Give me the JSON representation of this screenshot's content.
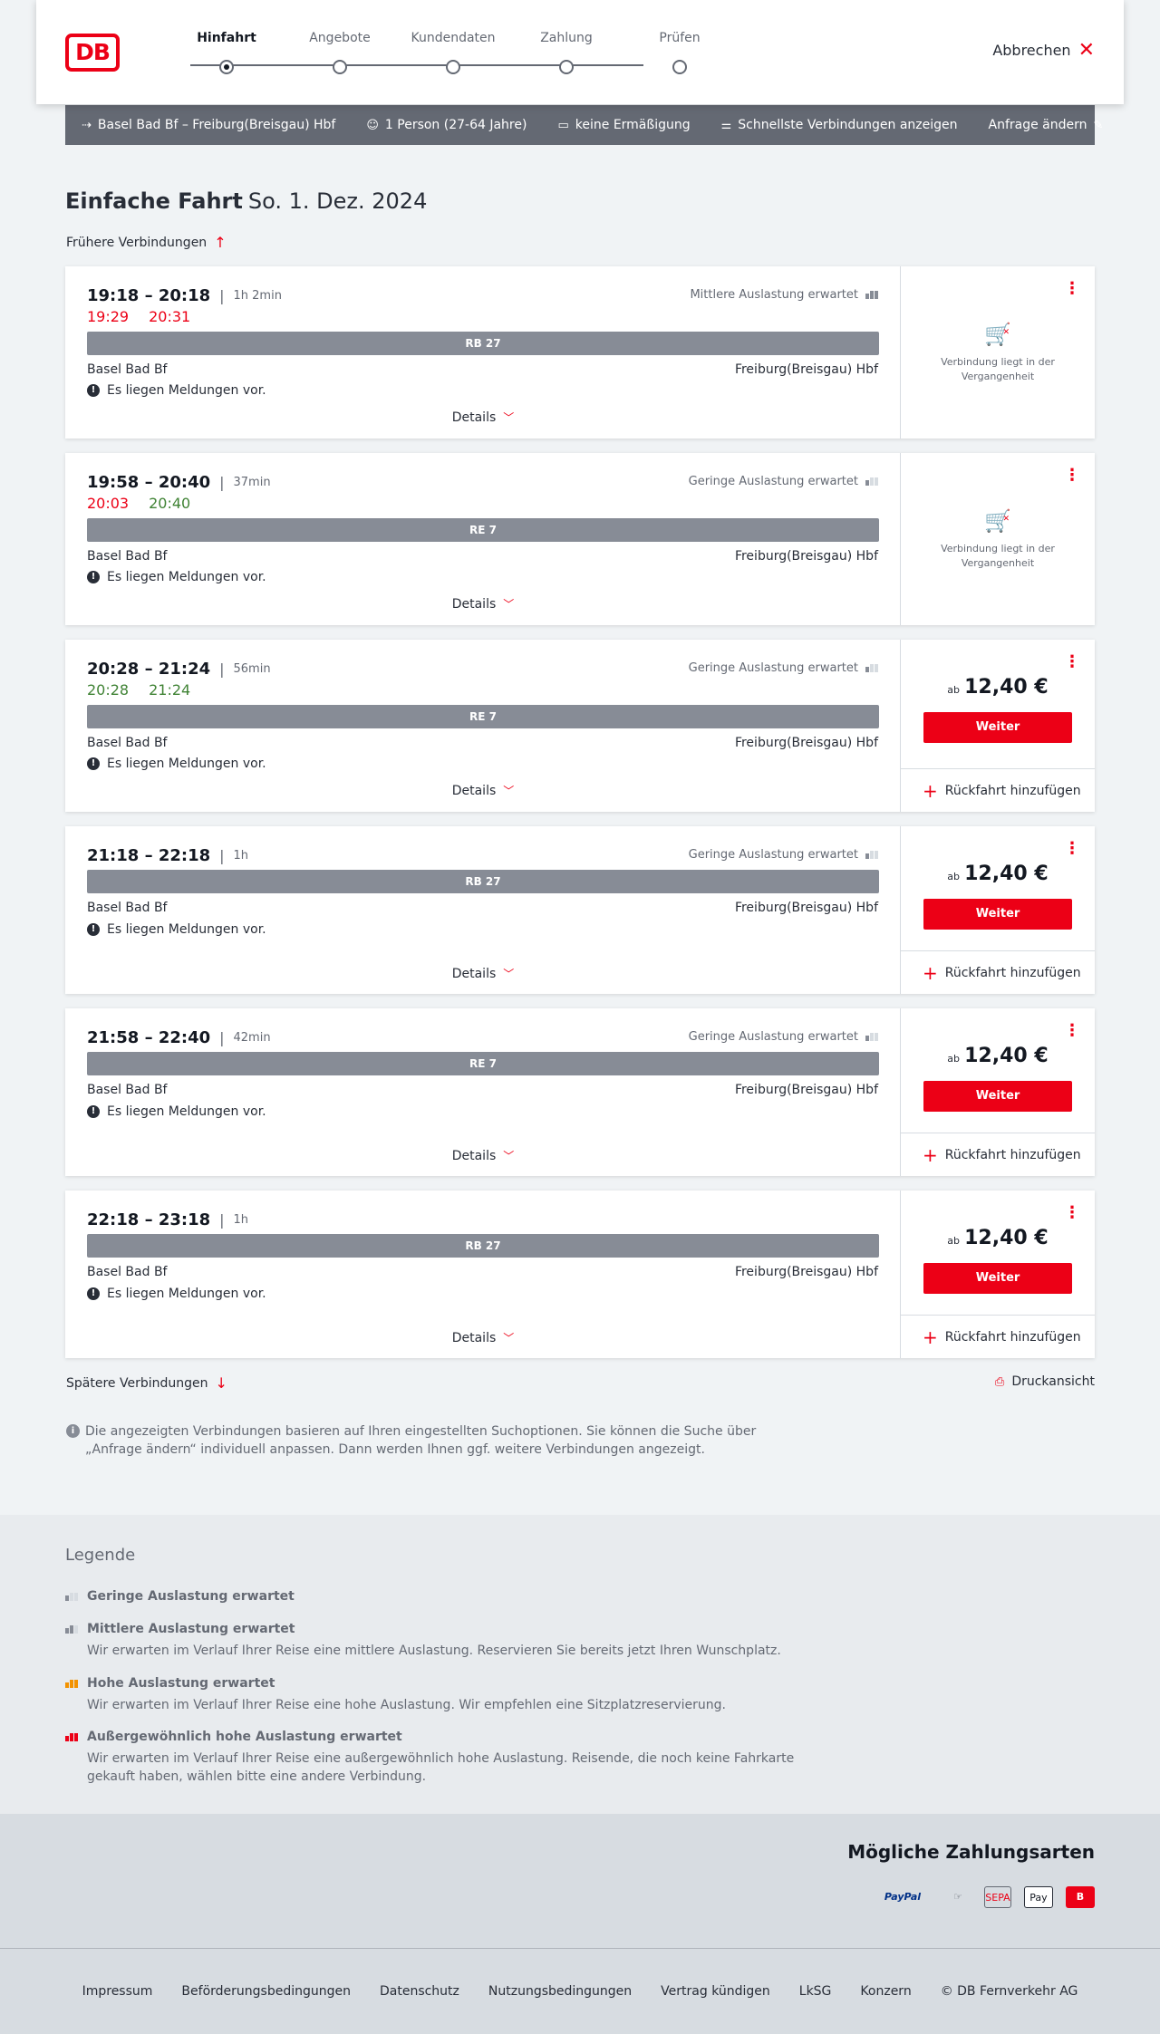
{
  "header": {
    "logo": "DB",
    "steps": [
      "Hinfahrt",
      "Angebote",
      "Kundendaten",
      "Zahlung",
      "Prüfen"
    ],
    "cancel_label": "Abbrechen"
  },
  "searchbar": {
    "route": "Basel Bad Bf – Freiburg(Breisgau) Hbf",
    "passengers": "1 Person (27-64 Jahre)",
    "discount": "keine Ermäßigung",
    "fastest": "Schnellste Verbindungen anzeigen",
    "edit": "Anfrage ändern"
  },
  "page": {
    "title": "Einfache Fahrt",
    "date": "So. 1. Dez. 2024",
    "earlier": "Frühere Verbindungen",
    "later": "Spätere Verbindungen",
    "print": "Druckansicht",
    "info": "Die angezeigten Verbindungen basieren auf Ihren eingestellten Suchoptionen. Sie können die Suche über „Anfrage ändern“ individuell anpassen. Dann werden Ihnen ggf. weitere Verbindungen angezeigt."
  },
  "connections": [
    {
      "time": "19:18 – 20:18",
      "duration": "1h 2min",
      "rt_dep": "19:29",
      "rt_arr": "20:31",
      "rt_dep_status": "late",
      "rt_arr_status": "late",
      "load": "Mittlere Auslastung erwartet",
      "train": "RB 27",
      "from": "Basel Bad Bf",
      "to": "Freiburg(Breisgau) Hbf",
      "message": "Es liegen Meldungen vor.",
      "details": "Details",
      "past": "Verbindung liegt in der Vergangenheit"
    },
    {
      "time": "19:58 – 20:40",
      "duration": "37min",
      "rt_dep": "20:03",
      "rt_arr": "20:40",
      "rt_dep_status": "late",
      "rt_arr_status": "ontime",
      "load": "Geringe Auslastung erwartet",
      "train": "RE 7",
      "from": "Basel Bad Bf",
      "to": "Freiburg(Breisgau) Hbf",
      "message": "Es liegen Meldungen vor.",
      "details": "Details",
      "past": "Verbindung liegt in der Vergangenheit"
    },
    {
      "time": "20:28 – 21:24",
      "duration": "56min",
      "rt_dep": "20:28",
      "rt_arr": "21:24",
      "rt_dep_status": "ontime",
      "rt_arr_status": "ontime",
      "load": "Geringe Auslastung erwartet",
      "train": "RE 7",
      "from": "Basel Bad Bf",
      "to": "Freiburg(Breisgau) Hbf",
      "message": "Es liegen Meldungen vor.",
      "details": "Details",
      "price_prefix": "ab",
      "price": "12,40 €",
      "continue": "Weiter",
      "return": "Rückfahrt hinzufügen"
    },
    {
      "time": "21:18 – 22:18",
      "duration": "1h",
      "load": "Geringe Auslastung erwartet",
      "train": "RB 27",
      "from": "Basel Bad Bf",
      "to": "Freiburg(Breisgau) Hbf",
      "message": "Es liegen Meldungen vor.",
      "details": "Details",
      "price_prefix": "ab",
      "price": "12,40 €",
      "continue": "Weiter",
      "return": "Rückfahrt hinzufügen"
    },
    {
      "time": "21:58 – 22:40",
      "duration": "42min",
      "load": "Geringe Auslastung erwartet",
      "train": "RE 7",
      "from": "Basel Bad Bf",
      "to": "Freiburg(Breisgau) Hbf",
      "message": "Es liegen Meldungen vor.",
      "details": "Details",
      "price_prefix": "ab",
      "price": "12,40 €",
      "continue": "Weiter",
      "return": "Rückfahrt hinzufügen"
    },
    {
      "time": "22:18 – 23:18",
      "duration": "1h",
      "train": "RB 27",
      "from": "Basel Bad Bf",
      "to": "Freiburg(Breisgau) Hbf",
      "message": "Es liegen Meldungen vor.",
      "details": "Details",
      "price_prefix": "ab",
      "price": "12,40 €",
      "continue": "Weiter",
      "return": "Rückfahrt hinzufügen"
    }
  ],
  "legend": {
    "title": "Legende",
    "items": [
      {
        "label": "Geringe Auslastung erwartet",
        "desc": ""
      },
      {
        "label": "Mittlere Auslastung erwartet",
        "desc": "Wir erwarten im Verlauf Ihrer Reise eine mittlere Auslastung. Reservieren Sie bereits jetzt Ihren Wunschplatz."
      },
      {
        "label": "Hohe Auslastung erwartet",
        "desc": "Wir erwarten im Verlauf Ihrer Reise eine hohe Auslastung. Wir empfehlen eine Sitzplatzreservierung."
      },
      {
        "label": "Außergewöhnlich hohe Auslastung erwartet",
        "desc": "Wir erwarten im Verlauf Ihrer Reise eine außergewöhnlich hohe Auslastung. Reisende, die noch keine Fahrkarte gekauft haben, wählen bitte eine andere Verbindung."
      }
    ]
  },
  "payment": {
    "title": "Mögliche Zahlungsarten",
    "methods": [
      "PayPal",
      "SEPA",
      "Pay"
    ]
  },
  "footer": {
    "links": [
      "Impressum",
      "Beförderungsbedingungen",
      "Datenschutz",
      "Nutzungsbedingungen",
      "Vertrag kündigen",
      "LkSG",
      "Konzern",
      "© DB Fernverkehr AG"
    ]
  }
}
